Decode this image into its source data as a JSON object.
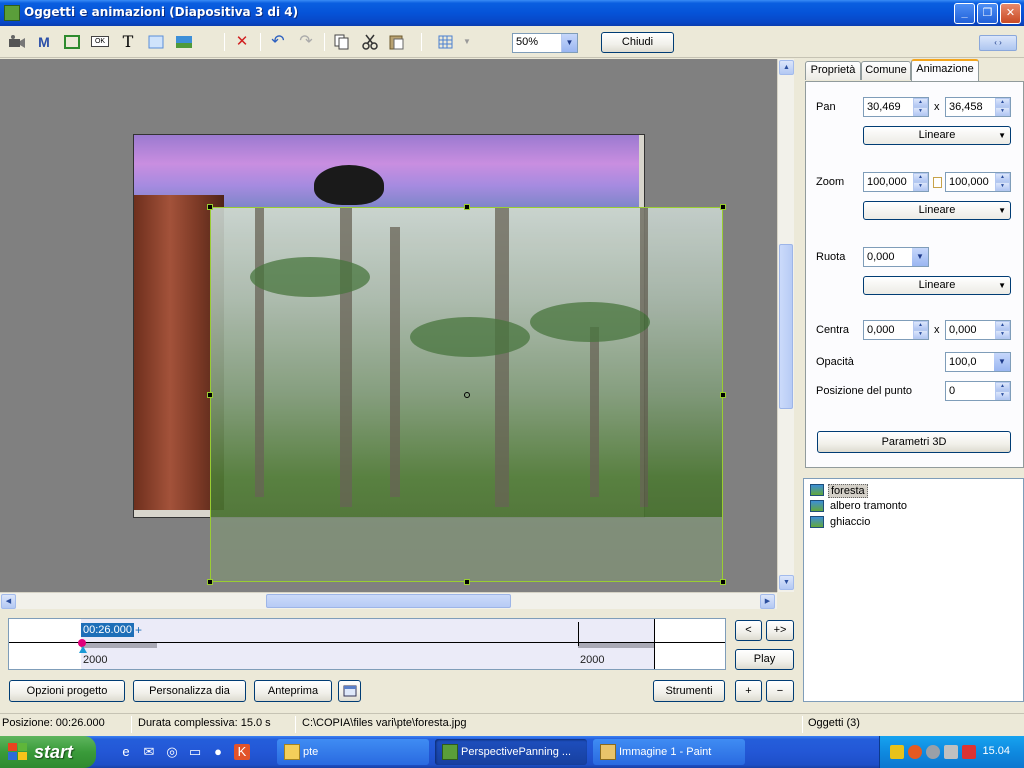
{
  "window": {
    "title": "Oggetti e animazioni  (Diapositiva 3 di 4)",
    "minimize_glyph": "_",
    "restore_glyph": "❐",
    "close_glyph": "✕"
  },
  "toolbar": {
    "zoom_value": "50%",
    "close_label": "Chiudi",
    "icons": [
      "camera-icon",
      "mask-icon",
      "frame-icon",
      "ok-button-icon",
      "text-icon",
      "rectangle-icon",
      "image-icon",
      "delete-icon",
      "undo-icon",
      "redo-icon",
      "copy-icon",
      "cut-icon",
      "paste-icon",
      "grid-icon"
    ],
    "mask_glyph": "M",
    "ok_glyph": "OK",
    "text_glyph": "T",
    "delete_glyph": "✕",
    "undo_glyph": "↶",
    "redo_glyph": "↷",
    "nav_glyph": "‹  ›"
  },
  "panel": {
    "tabs": [
      "Proprietà",
      "Comune",
      "Animazione"
    ],
    "active_tab": "Animazione",
    "pan_label": "Pan",
    "pan_x": "30,469",
    "pan_y": "36,458",
    "pan_interp": "Lineare",
    "zoom_label": "Zoom",
    "zoom_x": "100,000",
    "zoom_y": "100,000",
    "zoom_interp": "Lineare",
    "rotate_label": "Ruota",
    "rotate_value": "0,000",
    "rotate_interp": "Lineare",
    "center_label": "Centra",
    "center_x": "0,000",
    "center_y": "0,000",
    "times_sign": "x",
    "opacity_label": "Opacità",
    "opacity_value": "100,0",
    "keypoint_label": "Posizione del punto",
    "keypoint_value": "0",
    "params3d_label": "Parametri 3D"
  },
  "objects": {
    "items": [
      "foresta",
      "albero tramonto",
      "ghiaccio"
    ],
    "selected": "foresta"
  },
  "timeline": {
    "current_time": "00:26.000",
    "plus_mark": "+",
    "start_label": "2000",
    "end_label": "2000",
    "prev_label": "<",
    "next_label": "+>",
    "play_label": "Play"
  },
  "bottom_buttons": {
    "project_options": "Opzioni progetto",
    "customize_slide": "Personalizza dia",
    "preview": "Anteprima",
    "tools": "Strumenti",
    "plus": "+",
    "minus": "−"
  },
  "status": {
    "position": "Posizione:  00:26.000",
    "duration": "Durata complessiva:  15.0 s",
    "path": "C:\\COPIA\\files vari\\pte\\foresta.jpg",
    "objects_count": "Oggetti (3)"
  },
  "taskbar": {
    "start_label": "start",
    "tasks": [
      "pte",
      "PerspectivePanning ...",
      "Immagine 1 - Paint"
    ],
    "clock": "15.04"
  }
}
